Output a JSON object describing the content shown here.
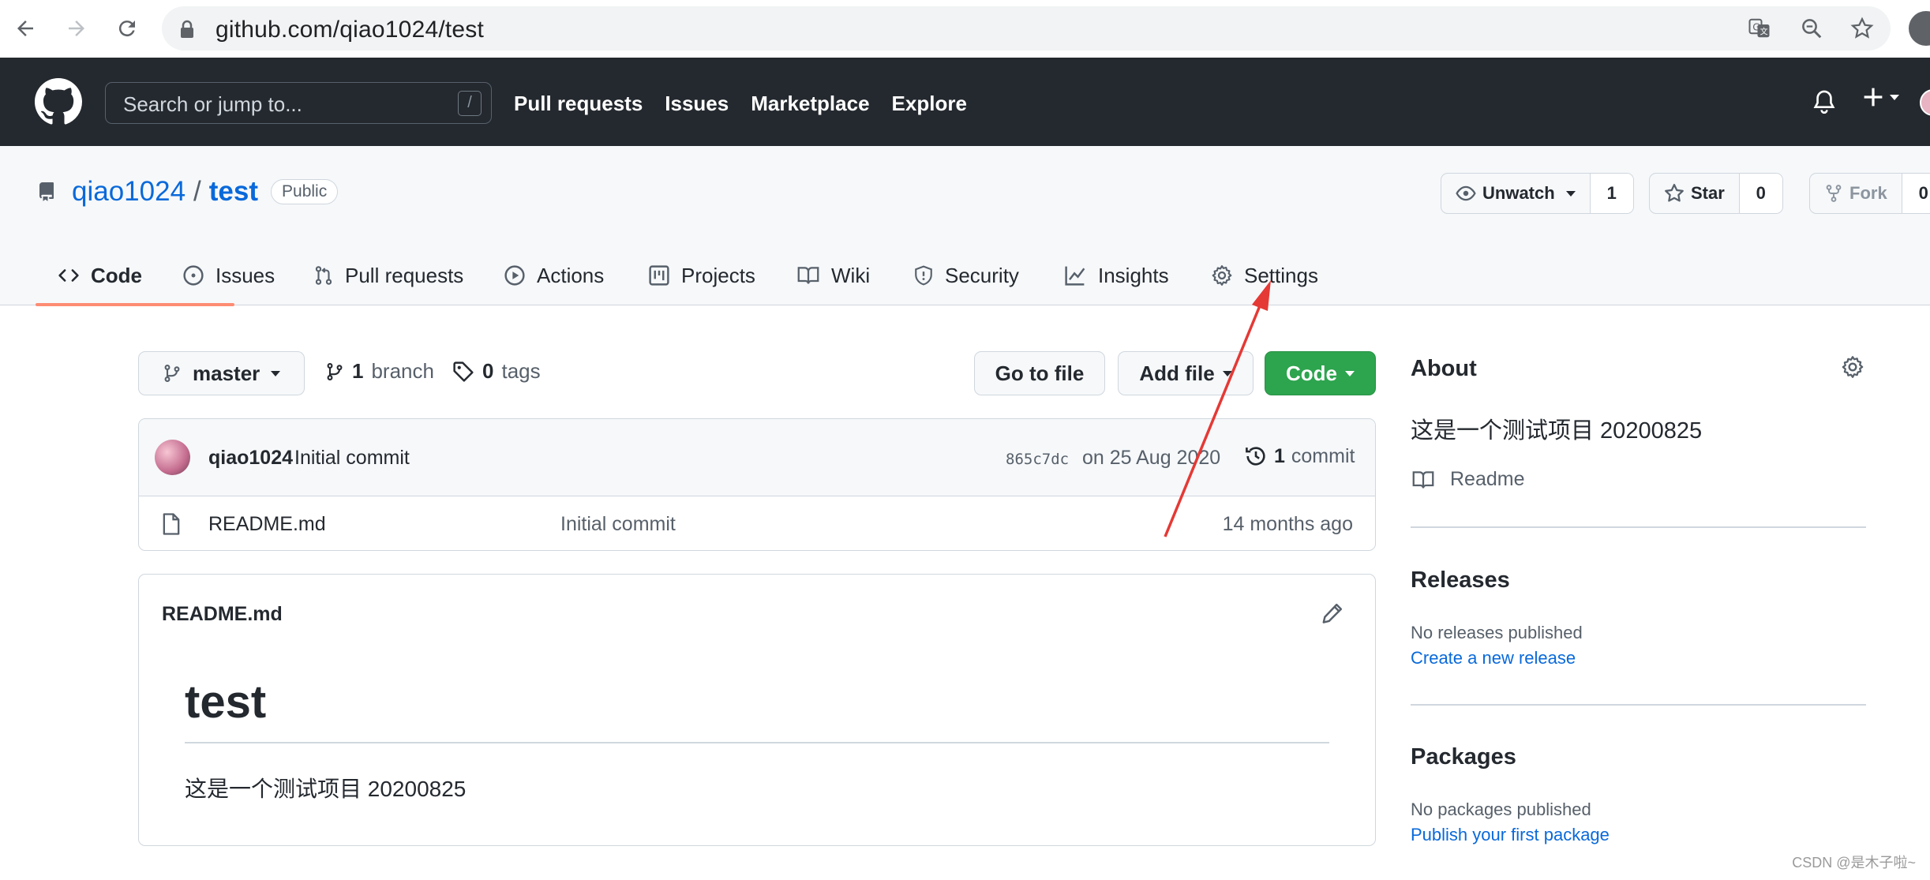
{
  "browser": {
    "url": "github.com/qiao1024/test"
  },
  "header": {
    "search_placeholder": "Search or jump to...",
    "search_shortcut": "/",
    "nav": [
      "Pull requests",
      "Issues",
      "Marketplace",
      "Explore"
    ]
  },
  "repo": {
    "owner": "qiao1024",
    "separator": "/",
    "name": "test",
    "visibility": "Public",
    "watch": {
      "label": "Unwatch",
      "count": "1"
    },
    "star": {
      "label": "Star",
      "count": "0"
    },
    "fork": {
      "label": "Fork",
      "count": "0"
    },
    "tabs": [
      "Code",
      "Issues",
      "Pull requests",
      "Actions",
      "Projects",
      "Wiki",
      "Security",
      "Insights",
      "Settings"
    ],
    "active_tab": "Code"
  },
  "toolbar": {
    "branch": "master",
    "branch_count": "1",
    "branch_label": "branch",
    "tag_count": "0",
    "tag_label": "tags",
    "go_to_file": "Go to file",
    "add_file": "Add file",
    "code": "Code"
  },
  "latest_commit": {
    "author": "qiao1024",
    "message": "Initial commit",
    "sha": "865c7dc",
    "date": "on 25 Aug 2020",
    "commit_count": "1",
    "commit_label": "commit"
  },
  "files": [
    {
      "name": "README.md",
      "message": "Initial commit",
      "age": "14 months ago"
    }
  ],
  "readme": {
    "title": "README.md",
    "heading": "test",
    "text": "这是一个测试项目 20200825"
  },
  "sidebar": {
    "about_heading": "About",
    "description": "这是一个测试项目 20200825",
    "readme_link": "Readme",
    "releases_heading": "Releases",
    "releases_text": "No releases published",
    "releases_link": "Create a new release",
    "packages_heading": "Packages",
    "packages_text": "No packages published",
    "packages_link": "Publish your first package"
  },
  "watermark": "CSDN @是木子啦~",
  "colors": {
    "header_bg": "#24292f",
    "link": "#0969da",
    "green_button": "#2da44e",
    "active_tab_underline": "#fd8c73",
    "annotation_arrow": "#e53935"
  }
}
